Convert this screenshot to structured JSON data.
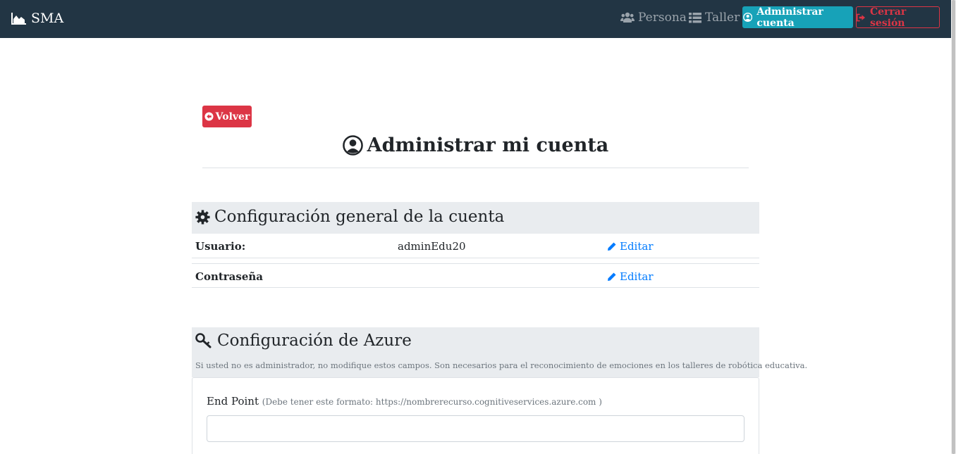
{
  "navbar": {
    "brand": "SMA",
    "links": [
      {
        "label": "Persona",
        "icon": "users-icon"
      },
      {
        "label": "Taller",
        "icon": "list-icon"
      }
    ],
    "account_button": "Administrar cuenta",
    "logout_button": "Cerrar sesión"
  },
  "page": {
    "back_button": "Volver",
    "title": "Administrar mi cuenta"
  },
  "general": {
    "heading": "Configuración general de la cuenta",
    "rows": [
      {
        "label": "Usuario:",
        "value": "adminEdu20",
        "action": "Editar"
      },
      {
        "label": "Contraseña",
        "value": "",
        "action": "Editar"
      }
    ]
  },
  "azure": {
    "heading": "Configuración de Azure",
    "note": "Si usted no es administrador, no modifique estos campos. Son necesarios para el reconocimiento de emociones en los talleres de robótica educativa.",
    "endpoint_label": "End Point",
    "endpoint_hint": "(Debe tener este formato: https://nombrerecurso.cognitiveservices.azure.com )",
    "endpoint_value": ""
  },
  "colors": {
    "navbar": "#223544",
    "info": "#17a2b8",
    "danger": "#dc3545",
    "link": "#007bff",
    "section_bg": "#e9ecef"
  }
}
